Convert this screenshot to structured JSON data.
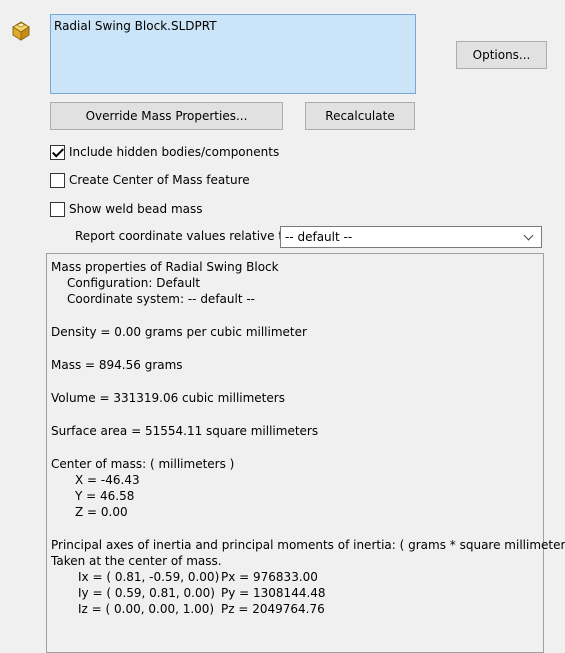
{
  "selection": {
    "items": [
      "Radial Swing Block.SLDPRT"
    ]
  },
  "buttons": {
    "options": "Options...",
    "override": "Override Mass Properties...",
    "recalculate": "Recalculate"
  },
  "checkboxes": [
    {
      "label": "Include hidden bodies/components",
      "checked": true
    },
    {
      "label": "Create Center of Mass feature",
      "checked": false
    },
    {
      "label": "Show weld bead mass",
      "checked": false
    }
  ],
  "coordinate": {
    "label": "Report coordinate values relative to:",
    "selected": "-- default --"
  },
  "results": {
    "header": "Mass properties of Radial Swing Block",
    "configuration": "Configuration: Default",
    "coordinate_system": "Coordinate system: -- default --",
    "density": "Density = 0.00 grams per cubic millimeter",
    "mass": "Mass = 894.56 grams",
    "volume": "Volume = 331319.06 cubic millimeters",
    "surface_area": "Surface area = 51554.11  square millimeters",
    "com_header": "Center of mass: ( millimeters )",
    "com_x": "X = -46.43",
    "com_y": "Y = 46.58",
    "com_z": "Z = 0.00",
    "principal_header": "Principal axes of inertia and principal moments of inertia: ( grams *  square millimeters )",
    "principal_sub": "Taken at the center of mass.",
    "ix": "Ix = ( 0.81, -0.59,  0.00)",
    "px": "Px = 976833.00",
    "iy": "Iy = ( 0.59,  0.81,  0.00)",
    "py": "Py = 1308144.48",
    "iz": "Iz = ( 0.00,  0.00,  1.00)",
    "pz": "Pz = 2049764.76"
  }
}
